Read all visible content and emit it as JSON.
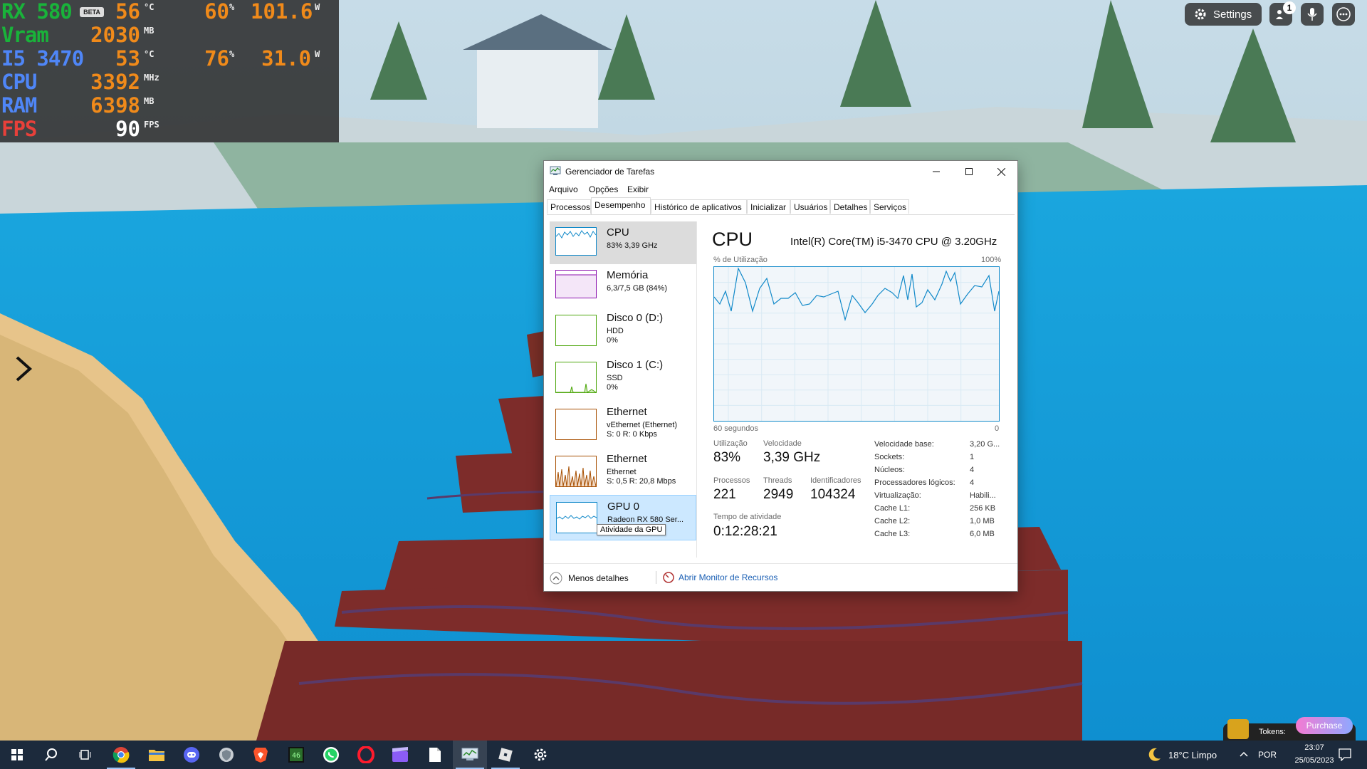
{
  "osd": {
    "gpu_label": "RX 580",
    "beta": "BETA",
    "gpu_temp": "56",
    "gpu_temp_unit": "°C",
    "gpu_load": "60",
    "gpu_load_unit": "%",
    "gpu_power": "101.6",
    "gpu_power_unit": "W",
    "vram_label": "Vram",
    "vram_val": "2030",
    "vram_unit": "MB",
    "cpu_model_label": "I5 3470",
    "cpu_temp": "53",
    "cpu_temp_unit": "°C",
    "cpu_load": "76",
    "cpu_load_unit": "%",
    "cpu_power": "31.0",
    "cpu_power_unit": "W",
    "cpu_label": "CPU",
    "cpu_clock": "3392",
    "cpu_clock_unit": "MHz",
    "ram_label": "RAM",
    "ram_val": "6398",
    "ram_unit": "MB",
    "fps_label": "FPS",
    "fps_val": "90",
    "fps_unit": "FPS"
  },
  "roblox": {
    "settings_label": "Settings",
    "notif_count": "1",
    "purchase_label": "Purchase",
    "tokens_label": "Tokens:"
  },
  "taskmgr": {
    "title": "Gerenciador de Tarefas",
    "menu": [
      "Arquivo",
      "Opções",
      "Exibir"
    ],
    "tabs": [
      "Processos",
      "Desempenho",
      "Histórico de aplicativos",
      "Inicializar",
      "Usuários",
      "Detalhes",
      "Serviços"
    ],
    "sidebar": [
      {
        "title": "CPU",
        "sub1": "83% 3,39 GHz",
        "sub2": "",
        "sub3": ""
      },
      {
        "title": "Memória",
        "sub1": "6,3/7,5 GB (84%)",
        "sub2": "",
        "sub3": ""
      },
      {
        "title": "Disco 0 (D:)",
        "sub1": "HDD",
        "sub2": "0%",
        "sub3": ""
      },
      {
        "title": "Disco 1 (C:)",
        "sub1": "SSD",
        "sub2": "0%",
        "sub3": ""
      },
      {
        "title": "Ethernet",
        "sub1": "vEthernet (Ethernet)",
        "sub2": "S: 0 R: 0 Kbps",
        "sub3": ""
      },
      {
        "title": "Ethernet",
        "sub1": "Ethernet",
        "sub2": "S: 0,5 R: 20,8 Mbps",
        "sub3": ""
      },
      {
        "title": "GPU 0",
        "sub1": "Radeon RX 580 Ser...",
        "sub2": "",
        "sub3": ""
      }
    ],
    "tooltip": "Atividade da GPU",
    "panel": {
      "title": "CPU",
      "model": "Intel(R) Core(TM) i5-3470 CPU @ 3.20GHz",
      "util_label": "% de Utilização",
      "max_label": "100%",
      "time_label": "60 segundos",
      "min_label": "0",
      "utilization_label": "Utilização",
      "utilization": "83%",
      "speed_label": "Velocidade",
      "speed": "3,39 GHz",
      "processes_label": "Processos",
      "processes": "221",
      "threads_label": "Threads",
      "threads": "2949",
      "handles_label": "Identificadores",
      "handles": "104324",
      "uptime_label": "Tempo de atividade",
      "uptime": "0:12:28:21",
      "specs": [
        {
          "k": "Velocidade base:",
          "v": "3,20 G..."
        },
        {
          "k": "Sockets:",
          "v": "1"
        },
        {
          "k": "Núcleos:",
          "v": "4"
        },
        {
          "k": "Processadores lógicos:",
          "v": "4"
        },
        {
          "k": "Virtualização:",
          "v": "Habili..."
        },
        {
          "k": "Cache L1:",
          "v": "256 KB"
        },
        {
          "k": "Cache L2:",
          "v": "1,0 MB"
        },
        {
          "k": "Cache L3:",
          "v": "6,0 MB"
        }
      ]
    },
    "fewer_details": "Menos detalhes",
    "resource_monitor": "Abrir Monitor de Recursos"
  },
  "taskbar": {
    "weather": "18°C  Limpo",
    "lang": "POR",
    "time": "23:07",
    "date": "25/05/2023"
  },
  "colors": {
    "cpu_graph": "#1189c9",
    "mem_graph": "#8b12ae",
    "disk_graph": "#4da60c",
    "eth_graph": "#a74f01",
    "gpu_graph": "#1189c9"
  }
}
